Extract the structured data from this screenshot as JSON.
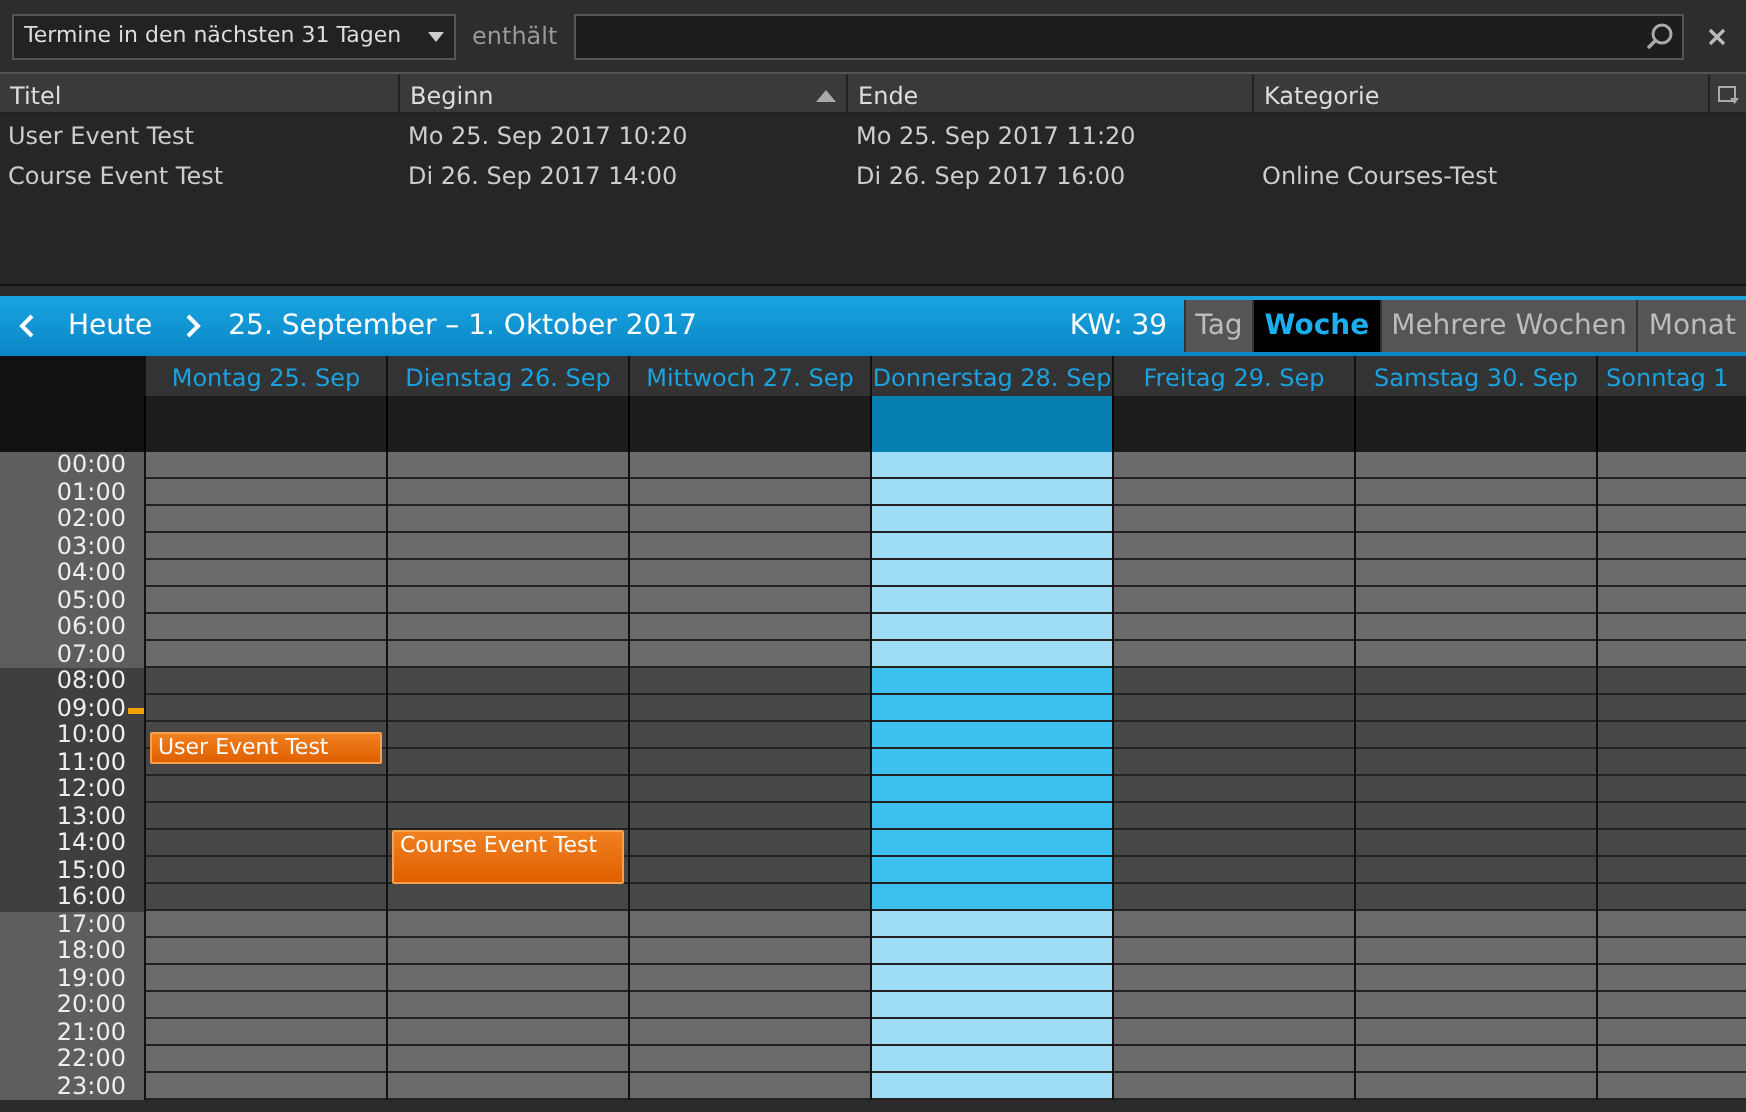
{
  "filter": {
    "range": "Termine in den nächsten 31 Tagen",
    "contains_label": "enthält"
  },
  "table": {
    "columns": [
      {
        "label": "Titel",
        "sorted": false
      },
      {
        "label": "Beginn",
        "sorted": true
      },
      {
        "label": "Ende",
        "sorted": false
      },
      {
        "label": "Kategorie",
        "sorted": false
      }
    ],
    "rows": [
      [
        "User Event Test",
        "Mo 25. Sep 2017 10:20",
        "Mo 25. Sep 2017 11:20",
        ""
      ],
      [
        "Course Event Test",
        "Di 26. Sep 2017 14:00",
        "Di 26. Sep 2017 16:00",
        "Online Courses-Test"
      ]
    ]
  },
  "calendar": {
    "today_button": "Heute",
    "range_title": "25. September – 1. Oktober 2017",
    "week_label": "KW: 39",
    "views": [
      {
        "label": "Tag",
        "selected": false
      },
      {
        "label": "Woche",
        "selected": true
      },
      {
        "label": "Mehrere Wochen",
        "selected": false
      },
      {
        "label": "Monat",
        "selected": false
      }
    ],
    "days": [
      {
        "label": "Montag 25. Sep",
        "selected": false,
        "events": [
          {
            "title": "User Event Test"
          }
        ]
      },
      {
        "label": "Dienstag 26. Sep",
        "selected": false,
        "events": [
          {
            "title": "Course Event Test"
          }
        ]
      },
      {
        "label": "Mittwoch 27. Sep",
        "selected": false
      },
      {
        "label": "Donnerstag 28. Sep",
        "selected": true
      },
      {
        "label": "Freitag 29. Sep",
        "selected": false
      },
      {
        "label": "Samstag 30. Sep",
        "selected": false
      },
      {
        "label": "Sonntag 1",
        "selected": false
      }
    ],
    "hours": [
      {
        "label": "00:00",
        "working": false,
        "current": false
      },
      {
        "label": "01:00",
        "working": false,
        "current": false
      },
      {
        "label": "02:00",
        "working": false,
        "current": false
      },
      {
        "label": "03:00",
        "working": false,
        "current": false
      },
      {
        "label": "04:00",
        "working": false,
        "current": false
      },
      {
        "label": "05:00",
        "working": false,
        "current": false
      },
      {
        "label": "06:00",
        "working": false,
        "current": false
      },
      {
        "label": "07:00",
        "working": false,
        "current": false
      },
      {
        "label": "08:00",
        "working": true,
        "current": false
      },
      {
        "label": "09:00",
        "working": true,
        "current": true
      },
      {
        "label": "10:00",
        "working": true,
        "current": false
      },
      {
        "label": "11:00",
        "working": true,
        "current": false
      },
      {
        "label": "12:00",
        "working": true,
        "current": false
      },
      {
        "label": "13:00",
        "working": true,
        "current": false
      },
      {
        "label": "14:00",
        "working": true,
        "current": false
      },
      {
        "label": "15:00",
        "working": true,
        "current": false
      },
      {
        "label": "16:00",
        "working": true,
        "current": false
      },
      {
        "label": "17:00",
        "working": false,
        "current": false
      },
      {
        "label": "18:00",
        "working": false,
        "current": false
      },
      {
        "label": "19:00",
        "working": false,
        "current": false
      },
      {
        "label": "20:00",
        "working": false,
        "current": false
      },
      {
        "label": "21:00",
        "working": false,
        "current": false
      },
      {
        "label": "22:00",
        "working": false,
        "current": false
      },
      {
        "label": "23:00",
        "working": false,
        "current": false
      }
    ]
  }
}
